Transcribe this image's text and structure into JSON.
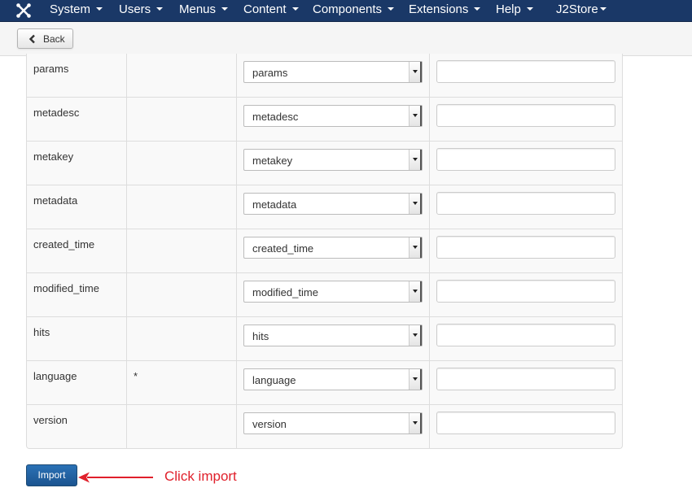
{
  "navbar": {
    "items": [
      {
        "label": "System"
      },
      {
        "label": "Users"
      },
      {
        "label": "Menus"
      },
      {
        "label": "Content"
      },
      {
        "label": "Components"
      },
      {
        "label": "Extensions"
      },
      {
        "label": "Help"
      },
      {
        "label": "J2Store"
      }
    ]
  },
  "toolbar": {
    "back_label": "Back"
  },
  "fields": [
    {
      "name": "params",
      "required": "",
      "selected": "params",
      "value": ""
    },
    {
      "name": "metadesc",
      "required": "",
      "selected": "metadesc",
      "value": ""
    },
    {
      "name": "metakey",
      "required": "",
      "selected": "metakey",
      "value": ""
    },
    {
      "name": "metadata",
      "required": "",
      "selected": "metadata",
      "value": ""
    },
    {
      "name": "created_time",
      "required": "",
      "selected": "created_time",
      "value": ""
    },
    {
      "name": "modified_time",
      "required": "",
      "selected": "modified_time",
      "value": ""
    },
    {
      "name": "hits",
      "required": "",
      "selected": "hits",
      "value": ""
    },
    {
      "name": "language",
      "required": "*",
      "selected": "language",
      "value": ""
    },
    {
      "name": "version",
      "required": "",
      "selected": "version",
      "value": ""
    }
  ],
  "actions": {
    "import_label": "Import"
  },
  "annotation": {
    "text": "Click import",
    "color": "#e0202b"
  },
  "colors": {
    "navbar_bg": "#1a3867",
    "primary_button": "#1b5490"
  },
  "icons": {
    "logo": "joomla-logo-icon",
    "back": "chevron-left-icon",
    "arrow": "arrow-left-icon"
  }
}
